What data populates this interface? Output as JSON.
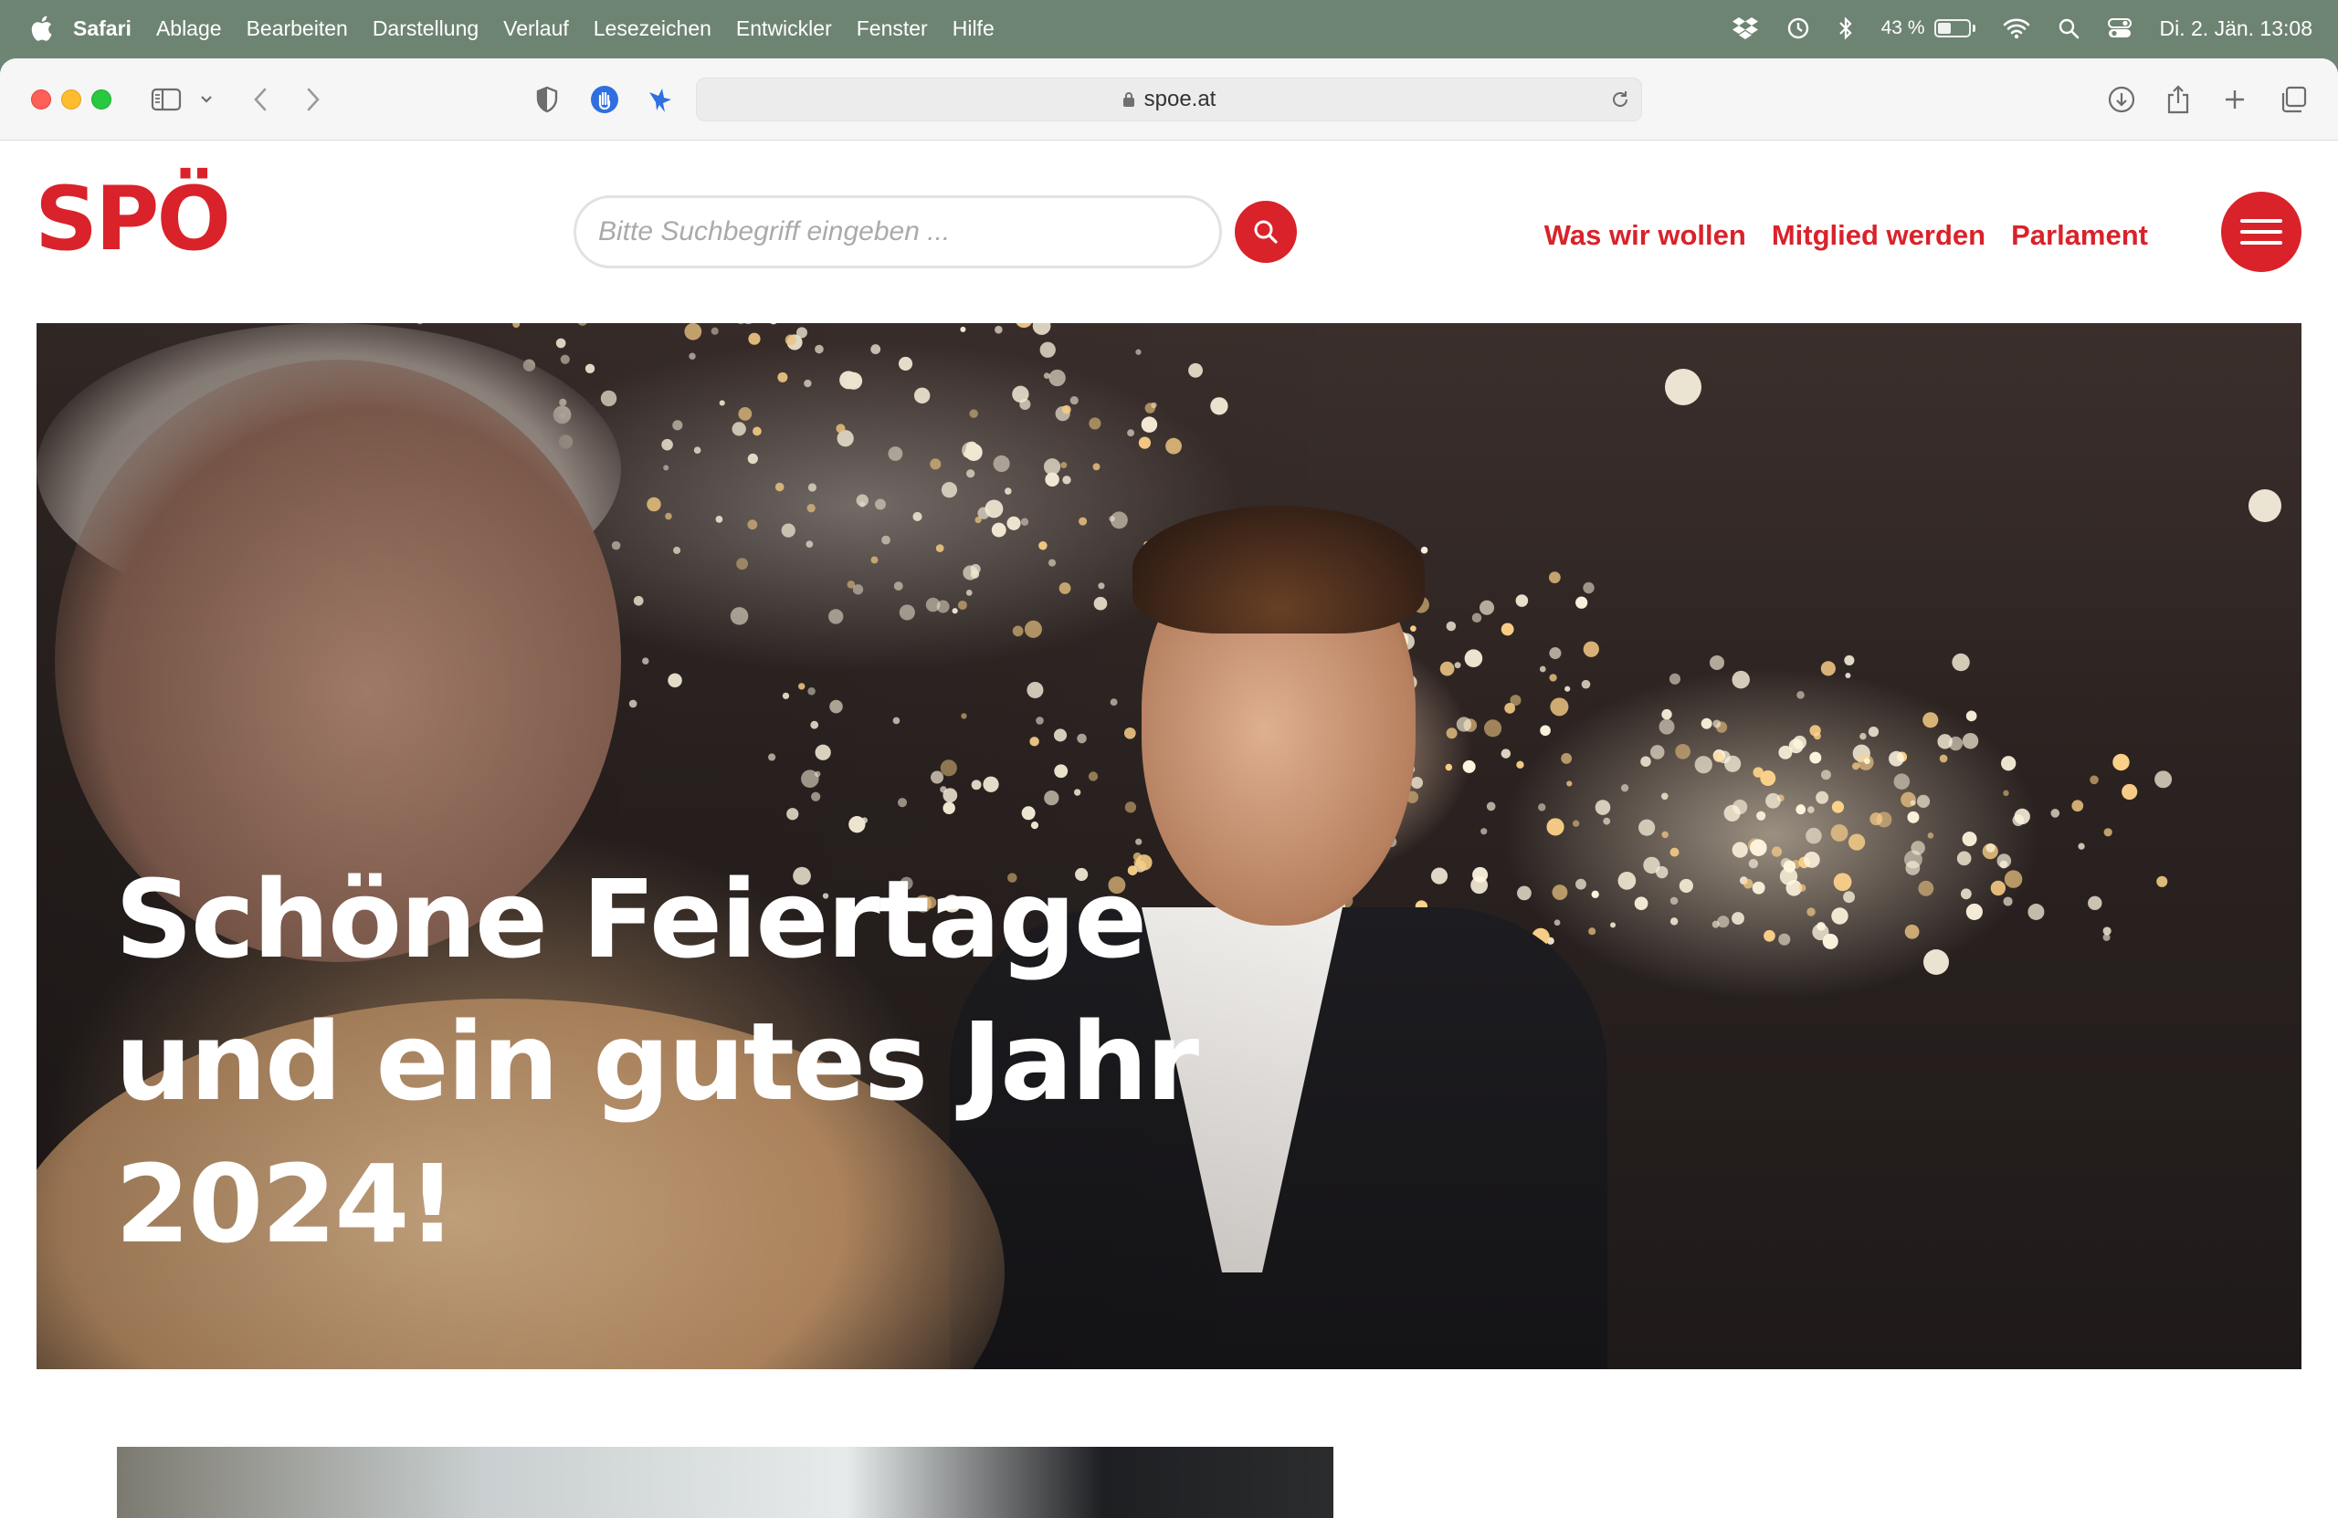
{
  "menubar": {
    "app_name": "Safari",
    "items": [
      "Ablage",
      "Bearbeiten",
      "Darstellung",
      "Verlauf",
      "Lesezeichen",
      "Entwickler",
      "Fenster",
      "Hilfe"
    ],
    "battery_percent_label": "43 %",
    "battery_level": 0.43,
    "datetime": "Di. 2. Jän. 13:08",
    "status_icons": [
      "dropbox-icon",
      "time-machine-icon",
      "bluetooth-icon",
      "battery-icon",
      "wifi-icon",
      "spotlight-icon",
      "control-center-icon"
    ]
  },
  "browser": {
    "url": "spoe.at",
    "toolbar_icons": [
      "sidebar-icon",
      "chevron-down-icon",
      "back-icon",
      "forward-icon",
      "privacy-shield-icon",
      "extension-hand-icon",
      "extension-bird-icon",
      "reload-icon",
      "download-icon",
      "share-icon",
      "new-tab-icon",
      "tab-overview-icon"
    ]
  },
  "site": {
    "logo": "SPÖ",
    "brand_color": "#d9222a",
    "search": {
      "placeholder": "Bitte Suchbegriff eingeben ..."
    },
    "nav": [
      "Was wir wollen",
      "Mitglied werden",
      "Parlament"
    ],
    "hero": {
      "title_line1": "Schöne Feiertage",
      "title_line2": "und ein gutes Jahr",
      "title_line3": "2024!"
    }
  }
}
